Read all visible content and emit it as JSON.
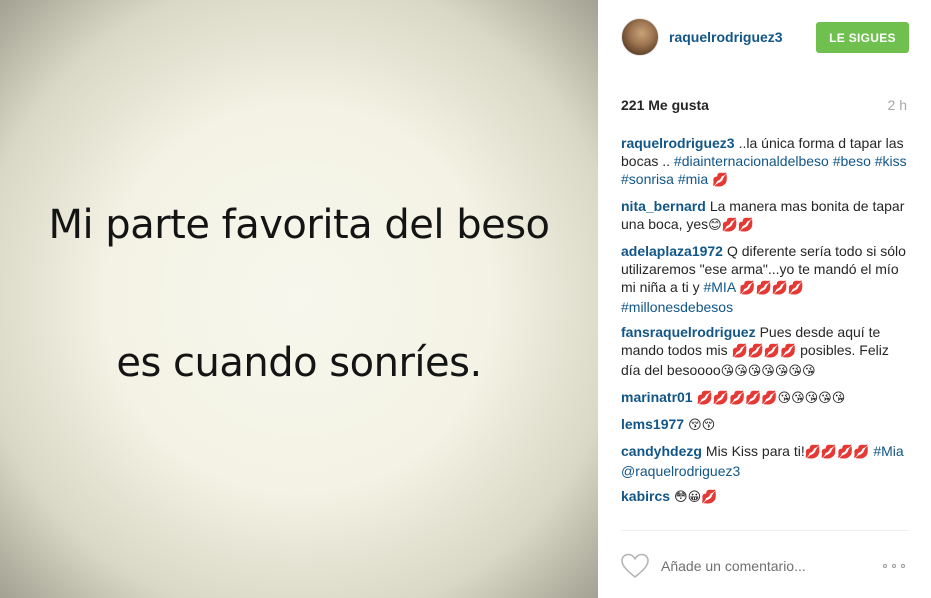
{
  "image": {
    "line1": "Mi parte favorita del beso",
    "line2": "es cuando sonríes."
  },
  "header": {
    "username": "raquelrodriguez3",
    "follow_label": "LE SIGUES",
    "follow_color": "#70c050"
  },
  "stats": {
    "likes": "221 Me gusta",
    "time": "2 h"
  },
  "comments": [
    {
      "author": "raquelrodriguez3",
      "parts": [
        {
          "t": "text",
          "v": "..la única forma d tapar las bocas .. "
        },
        {
          "t": "tag",
          "v": "#diainternacionaldelbeso"
        },
        {
          "t": "text",
          "v": " "
        },
        {
          "t": "tag",
          "v": "#beso"
        },
        {
          "t": "text",
          "v": " "
        },
        {
          "t": "tag",
          "v": "#kiss"
        },
        {
          "t": "text",
          "v": " "
        },
        {
          "t": "tag",
          "v": "#sonrisa"
        },
        {
          "t": "text",
          "v": " "
        },
        {
          "t": "tag",
          "v": "#mia"
        },
        {
          "t": "text",
          "v": " "
        },
        {
          "t": "emoji",
          "v": "💋"
        }
      ]
    },
    {
      "author": "nita_bernard",
      "parts": [
        {
          "t": "text",
          "v": "La manera mas bonita de tapar una boca, yes"
        },
        {
          "t": "emoji",
          "v": "😊💋💋"
        }
      ]
    },
    {
      "author": "adelaplaza1972",
      "parts": [
        {
          "t": "text",
          "v": "Q diferente sería todo si sólo utilizaremos \"ese arma\"...yo te mandó el mío mi niña a ti y "
        },
        {
          "t": "tag",
          "v": "#MIA"
        },
        {
          "t": "text",
          "v": " "
        },
        {
          "t": "emoji",
          "v": "💋💋💋💋"
        },
        {
          "t": "text",
          "v": " "
        },
        {
          "t": "tag",
          "v": "#millonesdebesos"
        }
      ]
    },
    {
      "author": "fansraquelrodriguez",
      "parts": [
        {
          "t": "text",
          "v": "Pues desde aquí te mando todos mis "
        },
        {
          "t": "emoji",
          "v": "💋💋💋💋"
        },
        {
          "t": "text",
          "v": " posibles. Feliz día del besoooo"
        },
        {
          "t": "emoji",
          "v": "😘😘😘😘😘😘😘"
        }
      ]
    },
    {
      "author": "marinatr01",
      "parts": [
        {
          "t": "emoji",
          "v": "💋💋💋💋💋😘😘😘😘😘"
        }
      ]
    },
    {
      "author": "lems1977",
      "parts": [
        {
          "t": "emoji",
          "v": "😚😚"
        }
      ]
    },
    {
      "author": "candyhdezg",
      "parts": [
        {
          "t": "text",
          "v": "Mis Kiss para ti!"
        },
        {
          "t": "emoji",
          "v": "💋💋💋💋"
        },
        {
          "t": "text",
          "v": " "
        },
        {
          "t": "tag",
          "v": "#Mia"
        },
        {
          "t": "text",
          "v": " "
        },
        {
          "t": "tag",
          "v": "@raquelrodriguez3"
        }
      ]
    },
    {
      "author": "kabircs",
      "parts": [
        {
          "t": "emoji",
          "v": "😳😀💋"
        }
      ]
    }
  ],
  "footer": {
    "placeholder": "Añade un comentario...",
    "like_icon": "heart-outline-icon",
    "more_icon": "more-options-icon"
  }
}
